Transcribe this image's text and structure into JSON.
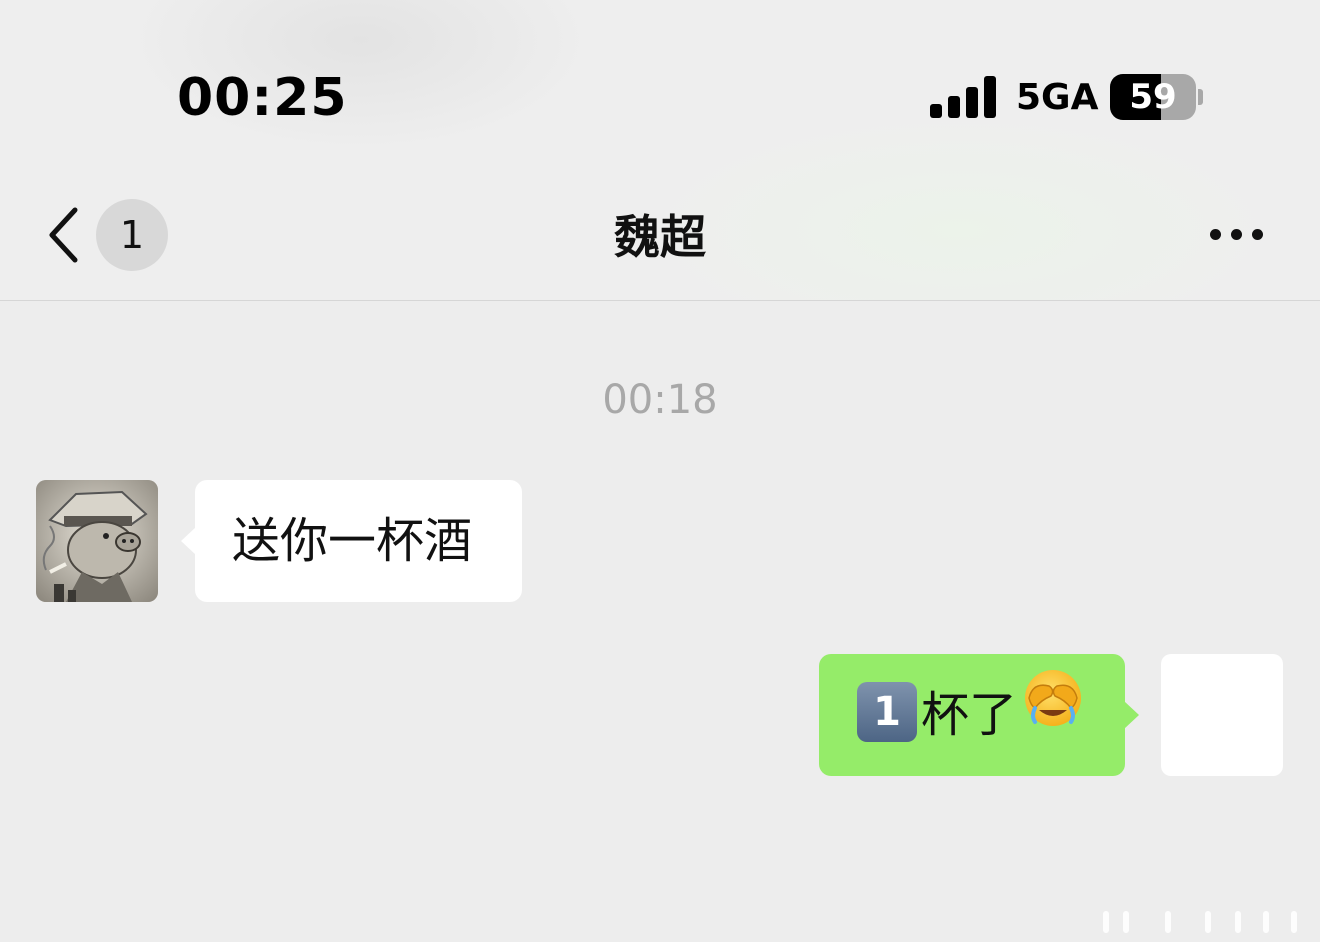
{
  "status_bar": {
    "time": "00:25",
    "network": "5GA",
    "battery_level": "59",
    "battery_fraction": 0.59,
    "signal_bars": 4
  },
  "nav": {
    "unread_count": "1",
    "title": "魏超",
    "back_icon": "chevron-left-icon",
    "more_icon": "more-dots-icon"
  },
  "chat": {
    "timestamp": "00:18",
    "messages": [
      {
        "side": "left",
        "text": "送你一杯酒"
      },
      {
        "side": "right",
        "emoji_keycap": "1",
        "text": "杯了",
        "emoji_icon": "face-covering-eyes-crying-emoji"
      }
    ]
  },
  "colors": {
    "background": "#ededed",
    "sent_bubble": "#95ec69",
    "received_bubble": "#ffffff",
    "timestamp": "#a8a8a8"
  }
}
